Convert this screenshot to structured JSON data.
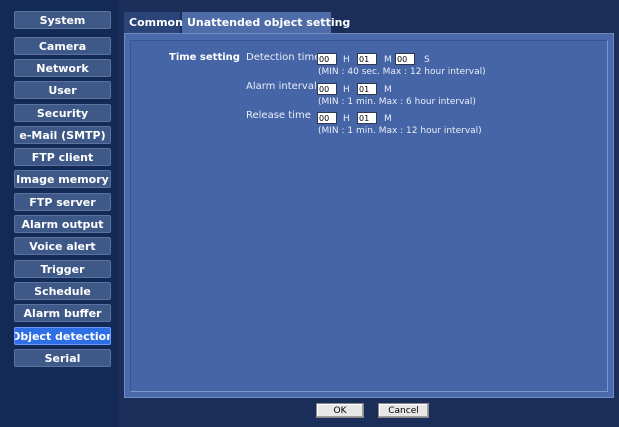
{
  "sidebar": {
    "items": [
      {
        "label": "System",
        "active": false
      },
      {
        "label": "Camera",
        "active": false
      },
      {
        "label": "Network",
        "active": false
      },
      {
        "label": "User",
        "active": false
      },
      {
        "label": "Security",
        "active": false
      },
      {
        "label": "e-Mail (SMTP)",
        "active": false
      },
      {
        "label": "FTP client",
        "active": false
      },
      {
        "label": "Image memory",
        "active": false
      },
      {
        "label": "FTP server",
        "active": false
      },
      {
        "label": "Alarm output",
        "active": false
      },
      {
        "label": "Voice alert",
        "active": false
      },
      {
        "label": "Trigger",
        "active": false
      },
      {
        "label": "Schedule",
        "active": false
      },
      {
        "label": "Alarm buffer",
        "active": false
      },
      {
        "label": "Object detection",
        "active": true
      },
      {
        "label": "Serial",
        "active": false
      }
    ]
  },
  "tabs": [
    {
      "label": "Common",
      "active": false
    },
    {
      "label": "Unattended object setting",
      "active": true
    }
  ],
  "time_setting": {
    "section_label": "Time setting",
    "detection_time": {
      "label": "Detection time",
      "hours": "00",
      "hours_unit": "H",
      "minutes": "01",
      "minutes_unit": "M",
      "seconds": "00",
      "seconds_unit": "S",
      "hint": "(MIN : 40 sec. Max : 12 hour interval)"
    },
    "alarm_interval": {
      "label": "Alarm interval",
      "hours": "00",
      "hours_unit": "H",
      "minutes": "01",
      "minutes_unit": "M",
      "hint": "(MIN : 1 min. Max : 6 hour interval)"
    },
    "release_time": {
      "label": "Release time",
      "hours": "00",
      "hours_unit": "H",
      "minutes": "01",
      "minutes_unit": "M",
      "hint": "(MIN : 1 min. Max : 12 hour interval)"
    }
  },
  "buttons": {
    "ok_label": "OK",
    "cancel_label": "Cancel"
  },
  "colors": {
    "sidebar_bg": "#132a56",
    "nav_item_bg": "#3e5887",
    "nav_item_active_bg": "#2f6fe6",
    "panel_bg": "#4a6aab",
    "tab_active_bg": "#4e6da8"
  }
}
